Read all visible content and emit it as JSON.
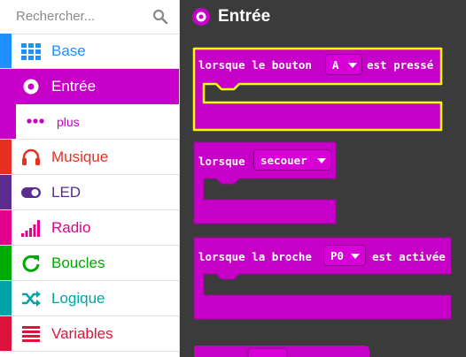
{
  "search": {
    "placeholder": "Rechercher..."
  },
  "categories": [
    {
      "label": "Base",
      "color": "#1e90ff",
      "icon": "grid-icon"
    },
    {
      "label": "Entrée",
      "color": "#c700c7",
      "icon": "target-icon",
      "selected": true
    },
    {
      "label": "Musique",
      "color": "#e63022",
      "icon": "headphones-icon"
    },
    {
      "label": "LED",
      "color": "#5c2d91",
      "icon": "toggle-icon"
    },
    {
      "label": "Radio",
      "color": "#e3008c",
      "icon": "signal-bars-icon"
    },
    {
      "label": "Boucles",
      "color": "#00aa00",
      "icon": "refresh-icon"
    },
    {
      "label": "Logique",
      "color": "#00a4a6",
      "icon": "shuffle-icon"
    },
    {
      "label": "Variables",
      "color": "#dc143c",
      "icon": "list-icon"
    }
  ],
  "subcategory": {
    "label": "plus",
    "icon": "dots-icon"
  },
  "flyout": {
    "title": "Entrée",
    "blocks": [
      {
        "text_before": "lorsque le bouton",
        "dropdown": "A",
        "text_after": "est pressé",
        "selected": true
      },
      {
        "text_before": "lorsque",
        "dropdown": "secouer",
        "text_after": ""
      },
      {
        "text_before": "lorsque la broche",
        "dropdown": "P0",
        "text_after": "est activée"
      }
    ]
  },
  "colors": {
    "input": "#c700c7",
    "workspace": "#3b3b3b",
    "highlight": "#ffff00"
  }
}
